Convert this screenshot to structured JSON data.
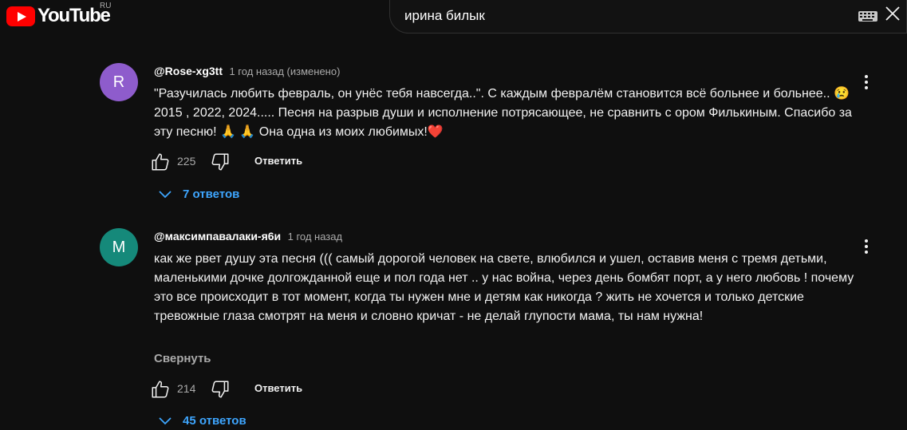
{
  "header": {
    "logo_text": "YouTube",
    "region": "RU",
    "search_query": "ирина билык"
  },
  "comments": [
    {
      "avatar_letter": "R",
      "avatar_color": "#8e5ccc",
      "author": "@Rose-xg3tt",
      "time": "1 год назад (изменено)",
      "text": "\"Разучилась любить февраль, он унёс тебя навсегда..\". С каждым февралём становится всё больнее и больнее.. 😢  2015 , 2022,  2024..... Песня на разрыв души и исполнение потрясающее, не сравнить с ором Филькиным. Спасибо за эту песню! 🙏 🙏 Она одна из моих любимых!❤️",
      "likes": "225",
      "reply_label": "Ответить",
      "replies_label": "7 ответов"
    },
    {
      "avatar_letter": "M",
      "avatar_color": "#15897a",
      "author": "@максимпавалаки-я6и",
      "time": "1 год назад",
      "text": "как же рвет душу эта песня ((( самый дорогой человек на свете, влюбился и ушел, оставив меня с тремя детьми, маленькими дочке долгожданной еще и пол года нет .. у нас война, через день бомбят порт, а у него любовь ! почему это все происходит в тот момент, когда ты нужен мне и детям как никогда ? жить не хочется и только детские тревожные глаза смотрят на меня и словно кричат - не делай глупости мама, ты нам нужна!",
      "collapse_label": "Свернуть",
      "likes": "214",
      "reply_label": "Ответить",
      "replies_label": "45 ответов"
    }
  ],
  "colors": {
    "background": "#0f0f0f",
    "link_blue": "#3ea6ff",
    "muted": "#aaaaaa"
  }
}
